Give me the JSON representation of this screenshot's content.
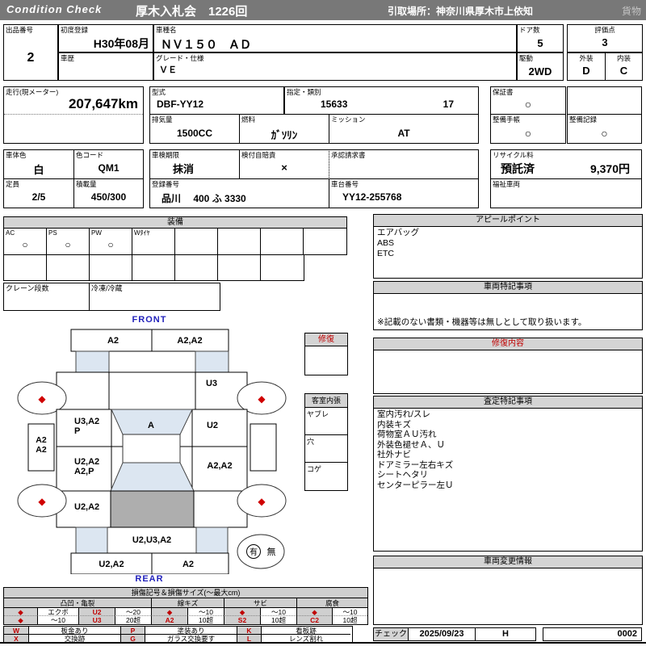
{
  "header": {
    "brand": "Condition  Check",
    "auction": "厚木入札会　1226回",
    "pickup": "引取場所：神奈川県厚木市上依知",
    "cargo": "貨物"
  },
  "icons": {
    "diamond": "◆",
    "circle": "○",
    "cross": "×"
  },
  "fields": {
    "lot": {
      "label": "出品番号",
      "value": "2"
    },
    "first_reg": {
      "label": "初度登録",
      "value": "H30年08月"
    },
    "history": {
      "label": "車歴",
      "value": ""
    },
    "model_name": {
      "label": "車種名",
      "value": "ＮＶ１５０　ＡＤ"
    },
    "grade": {
      "label": "グレード・仕様",
      "value": "ＶＥ"
    },
    "doors": {
      "label": "ドア数",
      "value": "5"
    },
    "score": {
      "label": "評価点",
      "value": "3"
    },
    "drive": {
      "label": "駆動",
      "value": "2WD"
    },
    "exterior": {
      "label": "外装",
      "value": "D"
    },
    "interior": {
      "label": "内装",
      "value": "C"
    },
    "mileage": {
      "label": "走行(現メーター)",
      "value": "207,647km"
    },
    "model_code": {
      "label": "型式",
      "value": "DBF-YY12"
    },
    "class": {
      "label": "指定・類別",
      "value1": "15633",
      "value2": "17"
    },
    "displacement": {
      "label": "排気量",
      "value": "1500CC"
    },
    "fuel": {
      "label": "燃料",
      "value": "ｶﾞｿﾘﾝ"
    },
    "mission": {
      "label": "ミッション",
      "value": "AT"
    },
    "warranty": {
      "label": "保証書",
      "value": "○"
    },
    "maintenance_book": {
      "label": "整備手帳",
      "value": "○"
    },
    "maintenance_record": {
      "label": "整備記録",
      "value": "○"
    },
    "body_color": {
      "label": "車体色",
      "value": "白"
    },
    "color_code": {
      "label": "色コード",
      "value": "QM1"
    },
    "inspection": {
      "label": "車検期限",
      "value": "抹消"
    },
    "insurance": {
      "label": "検付自賠責",
      "value": "×"
    },
    "approval": {
      "label": "承認請求書",
      "value": ""
    },
    "recycle": {
      "label": "リサイクル料",
      "status": "預託済",
      "fee": "9,370円"
    },
    "capacity": {
      "label": "定員",
      "value": "2/5"
    },
    "load": {
      "label": "積載量",
      "value": "450/300"
    },
    "reg_no": {
      "label": "登録番号",
      "value": "品川　 400 ふ 3330"
    },
    "chassis": {
      "label": "車台番号",
      "value": "YY12-255768"
    },
    "welfare": {
      "label": "福祉車両",
      "value": ""
    }
  },
  "equipment": {
    "title": "装備",
    "row1": [
      {
        "label": "AC",
        "value": "○"
      },
      {
        "label": "PS",
        "value": "○"
      },
      {
        "label": "PW",
        "value": "○"
      },
      {
        "label": "Wﾀｲﾔ",
        "value": ""
      },
      {
        "label": "",
        "value": ""
      },
      {
        "label": "",
        "value": ""
      },
      {
        "label": "",
        "value": ""
      },
      {
        "label": "",
        "value": ""
      }
    ],
    "crane_label": "クレーン段数",
    "reefer_label": "冷凍/冷蔵"
  },
  "diagram": {
    "front_label": "FRONT",
    "rear_label": "REAR",
    "front_bumper_left": "A2",
    "front_bumper_right": "A2,A2",
    "right_fender": "U3",
    "left_front_door_1": "U3,A2",
    "left_front_door_2": "P",
    "windshield": "A",
    "right_front_door": "U2",
    "left_sill_1": "A2",
    "left_sill_2": "A2",
    "left_rear_door_1": "U2,A2",
    "left_rear_door_2": "A2,P",
    "right_rear_door": "A2,A2",
    "left_quarter": "U2,A2",
    "rear_panel": "U2,U3,A2",
    "rear_bumper_left": "U2,A2",
    "rear_bumper_right": "A2",
    "spare_yes": "有",
    "spare_no": "無",
    "repair_box_title": "修復",
    "interior_box_title": "客室内張",
    "interior_rows": [
      "ヤブレ",
      "穴",
      "コゲ"
    ]
  },
  "panels": {
    "appeal": {
      "title": "アピールポイント",
      "lines": [
        "エアバッグ",
        "ABS",
        "ETC"
      ]
    },
    "vehicle_notes": {
      "title": "車両特記事項",
      "note": "※記載のない書類・機器等は無しとして取り扱います。"
    },
    "repair_detail": {
      "title": "修復内容"
    },
    "assessment": {
      "title": "査定特記事項",
      "lines": [
        "室内汚れ/スレ",
        "内装キズ",
        "荷物室ＡＵ汚れ",
        "外装色褪せＡ、Ｕ",
        "社外ナビ",
        "ドアミラー左右キズ",
        "シートヘタリ",
        "センターピラー左Ｕ"
      ]
    },
    "change_info": {
      "title": "車両変更情報"
    },
    "check": {
      "label": "チェック",
      "date": "2025/09/23",
      "inspector": "H",
      "serial": "0002"
    }
  },
  "legend": {
    "title": "損傷記号＆損傷サイズ(～最大cm)",
    "groups": [
      "凸凹・亀裂",
      "線キズ",
      "サビ",
      "腐食"
    ],
    "dent": {
      "r1_name": "エクボ",
      "r1_code": "U2",
      "r1_size": "～20",
      "r2_name": "～10",
      "r2_code": "U3",
      "r2_size": "20超"
    },
    "scratch": {
      "r1_size": "～10",
      "r2_code": "A2",
      "r2_size": "10超"
    },
    "rust": {
      "r1_size": "～10",
      "r2_code": "S2",
      "r2_size": "10超"
    },
    "corrosion": {
      "r1_size": "～10",
      "r2_code": "C2",
      "r2_size": "10超"
    },
    "letters": [
      {
        "code": "W",
        "desc": "板金あり"
      },
      {
        "code": "P",
        "desc": "塗装あり"
      },
      {
        "code": "K",
        "desc": "看板跡"
      },
      {
        "code": "X",
        "desc": "交換跡"
      },
      {
        "code": "G",
        "desc": "ガラス交換要す"
      },
      {
        "code": "L",
        "desc": "レンズ割れ"
      }
    ]
  }
}
